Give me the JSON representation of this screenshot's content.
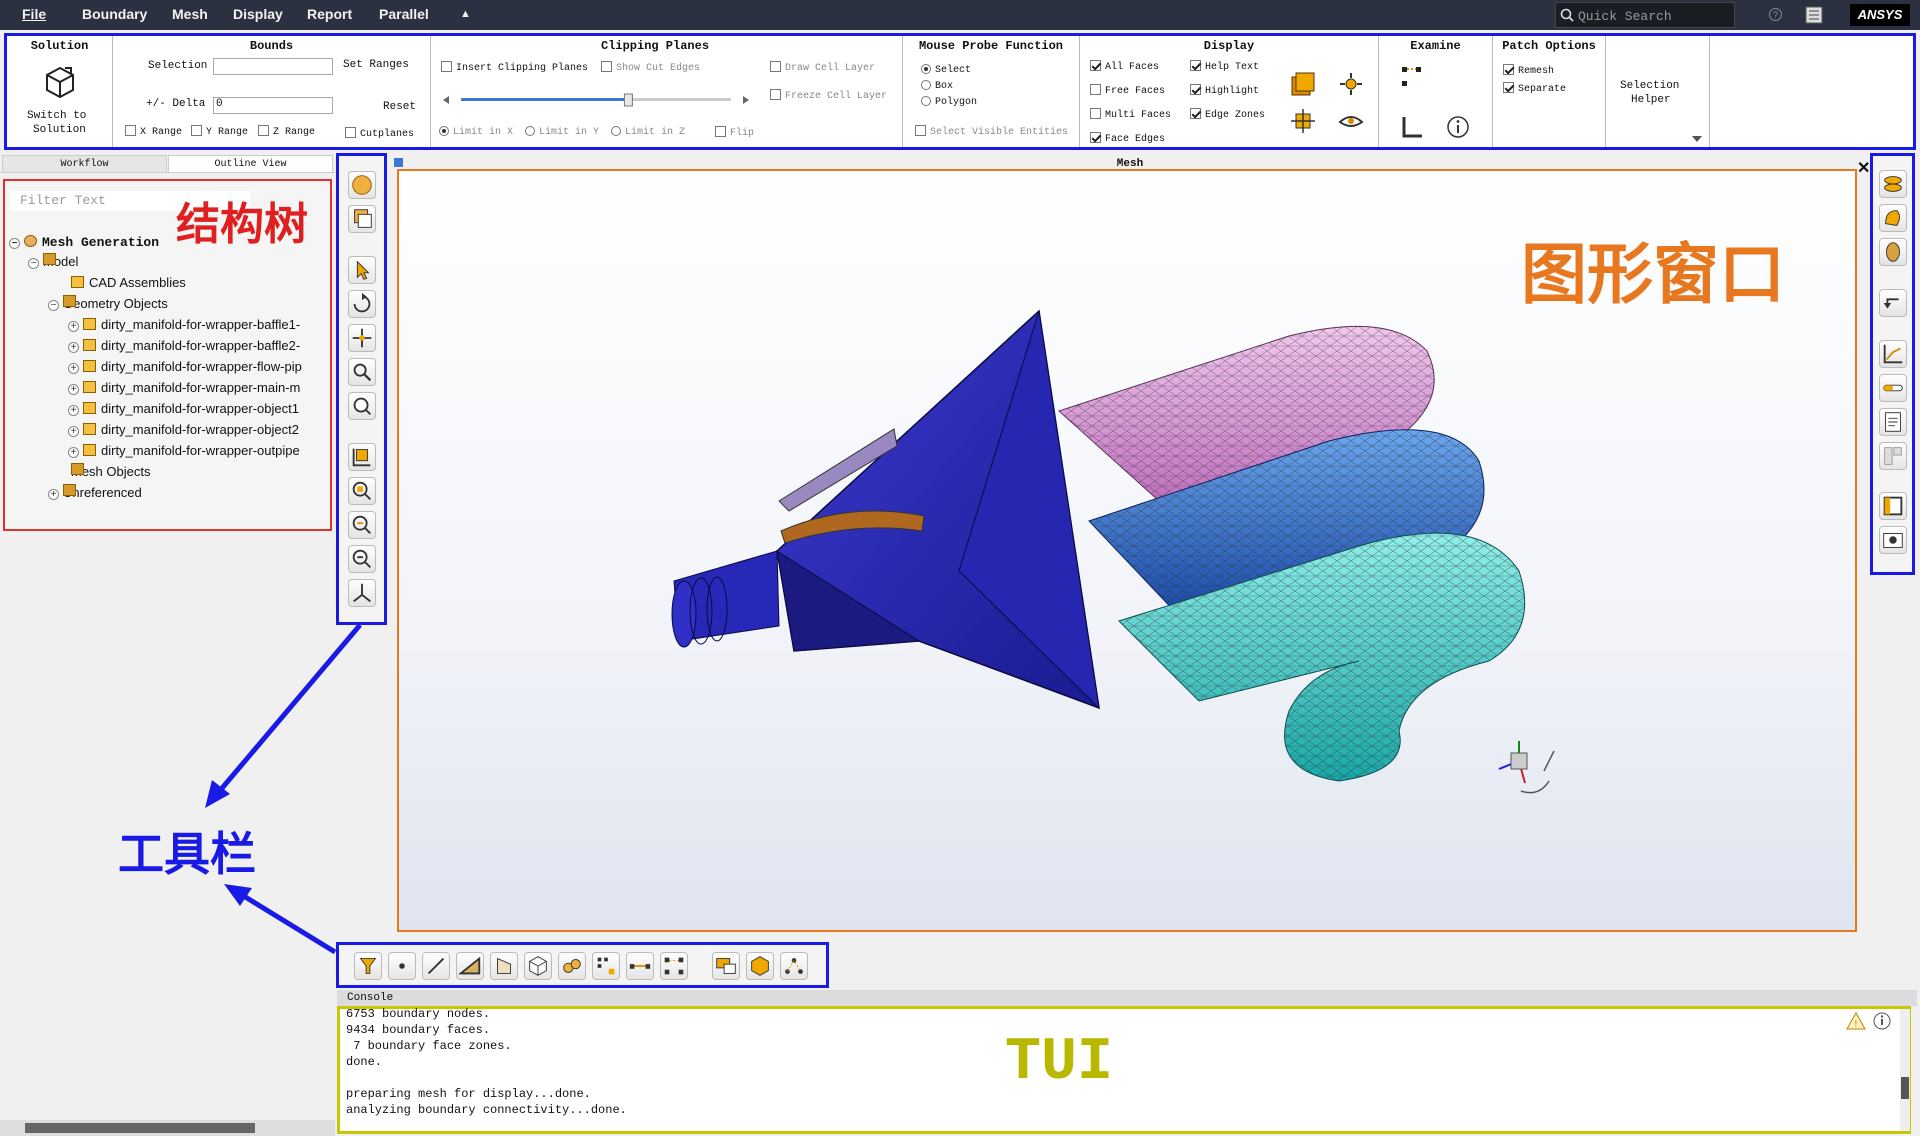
{
  "menu": {
    "file": "File",
    "items": [
      "Boundary",
      "Mesh",
      "Display",
      "Report",
      "Parallel"
    ],
    "collapse": "▲"
  },
  "search": {
    "placeholder": "Quick Search"
  },
  "brand": "ANSYS",
  "ribbon": {
    "solution": {
      "title": "Solution",
      "button": "Switch to\nSolution",
      "line1": "Switch to",
      "line2": "Solution"
    },
    "bounds": {
      "title": "Bounds",
      "selection": "Selection",
      "set_ranges": "Set Ranges",
      "delta": "+/- Delta",
      "delta_value": "0",
      "reset": "Reset",
      "x_range": "X Range",
      "y_range": "Y Range",
      "z_range": "Z Range",
      "cutplanes": "Cutplanes"
    },
    "clipping": {
      "title": "Clipping Planes",
      "insert": "Insert Clipping Planes",
      "show_cut": "Show Cut Edges",
      "draw_cell": "Draw Cell Layer",
      "freeze_cell": "Freeze Cell Layer",
      "limit_x": "Limit in X",
      "limit_y": "Limit in Y",
      "limit_z": "Limit in Z",
      "flip": "Flip",
      "slider_value": 0.62
    },
    "probe": {
      "title": "Mouse Probe Function",
      "select": "Select",
      "box": "Box",
      "polygon": "Polygon",
      "visible": "Select Visible Entities"
    },
    "display": {
      "title": "Display",
      "all_faces": "All Faces",
      "free_faces": "Free Faces",
      "multi_faces": "Multi Faces",
      "face_edges": "Face Edges",
      "help_text": "Help Text",
      "highlight": "Highlight",
      "edge_zones": "Edge Zones"
    },
    "examine": {
      "title": "Examine"
    },
    "patch": {
      "title": "Patch Options",
      "remesh": "Remesh",
      "separate": "Separate"
    },
    "selection_helper": {
      "line1": "Selection",
      "line2": "Helper"
    }
  },
  "tabs": {
    "workflow": "Workflow",
    "outline": "Outline View"
  },
  "tree": {
    "filter_placeholder": "Filter Text",
    "root": "Mesh Generation",
    "model": "Model",
    "cad": "CAD Assemblies",
    "geometry": "Geometry Objects",
    "objects": [
      "dirty_manifold-for-wrapper-baffle1-",
      "dirty_manifold-for-wrapper-baffle2-",
      "dirty_manifold-for-wrapper-flow-pip",
      "dirty_manifold-for-wrapper-main-m",
      "dirty_manifold-for-wrapper-object1",
      "dirty_manifold-for-wrapper-object2",
      "dirty_manifold-for-wrapper-outpipe"
    ],
    "mesh_objects": "Mesh Objects",
    "unreferenced": "Unreferenced"
  },
  "annotations": {
    "tree": "结构树",
    "graphics": "图形窗口",
    "toolbar": "工具栏",
    "tui": "TUI"
  },
  "graphics": {
    "title": "Mesh",
    "close": "✕"
  },
  "console": {
    "header": "Console",
    "lines": [
      "6753 boundary nodes.",
      "9434 boundary faces.",
      " 7 boundary face zones.",
      "done.",
      "",
      "preparing mesh for display...done.",
      "analyzing boundary connectivity...done."
    ]
  },
  "colors": {
    "ribbon_border": "#1a1ae6",
    "tree_border": "#e03030",
    "graphics_border": "#e8781f",
    "console_border": "#c8c800",
    "body": "#2b2bb0",
    "pipe_pink": "#e8a8e0",
    "pipe_blue": "#2d6ed8",
    "pipe_cyan": "#30d8d0"
  }
}
